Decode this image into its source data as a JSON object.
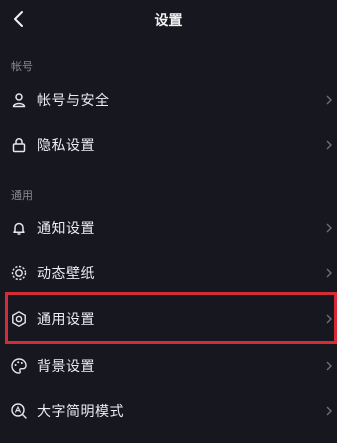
{
  "header": {
    "title": "设置",
    "back_icon": "chevron-left-icon"
  },
  "sections": {
    "account": {
      "label": "帐号",
      "items": [
        {
          "label": "帐号与安全",
          "icon": "user-icon"
        },
        {
          "label": "隐私设置",
          "icon": "lock-icon"
        }
      ]
    },
    "general": {
      "label": "通用",
      "items": [
        {
          "label": "通知设置",
          "icon": "bell-icon"
        },
        {
          "label": "动态壁纸",
          "icon": "sun-wallpaper-icon"
        },
        {
          "label": "通用设置",
          "icon": "gear-icon",
          "highlighted": true
        },
        {
          "label": "背景设置",
          "icon": "palette-icon"
        },
        {
          "label": "大字简明模式",
          "icon": "text-search-icon"
        }
      ]
    }
  },
  "colors": {
    "background": "#17171f",
    "text": "#ececf1",
    "muted": "#8a8a94",
    "highlight": "#d42b36"
  }
}
